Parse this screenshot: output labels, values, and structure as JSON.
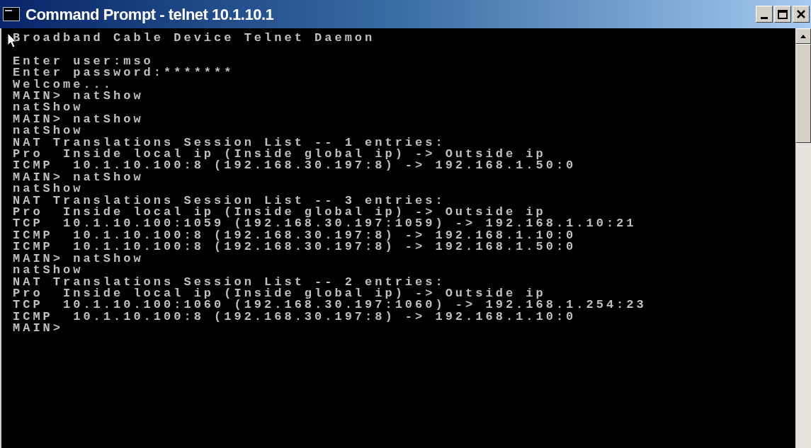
{
  "window": {
    "title": "Command Prompt - telnet 10.1.10.1"
  },
  "terminal": {
    "banner": "Broadband Cable Device Telnet Daemon",
    "lines": [
      "Enter user:mso",
      "Enter password:*******",
      "Welcome...",
      "MAIN> natShow",
      "natShow",
      "MAIN> natShow",
      "natShow",
      "NAT Translations Session List -- 1 entries:",
      "Pro  Inside local ip (Inside global ip) -> Outside ip",
      "ICMP  10.1.10.100:8 (192.168.30.197:8) -> 192.168.1.50:0",
      "MAIN> natShow",
      "natShow",
      "NAT Translations Session List -- 3 entries:",
      "Pro  Inside local ip (Inside global ip) -> Outside ip",
      "TCP  10.1.10.100:1059 (192.168.30.197:1059) -> 192.168.1.10:21",
      "ICMP  10.1.10.100:8 (192.168.30.197:8) -> 192.168.1.10:0",
      "ICMP  10.1.10.100:8 (192.168.30.197:8) -> 192.168.1.50:0",
      "MAIN> natShow",
      "natShow",
      "NAT Translations Session List -- 2 entries:",
      "Pro  Inside local ip (Inside global ip) -> Outside ip",
      "TCP  10.1.10.100:1060 (192.168.30.197:1060) -> 192.168.1.254:23",
      "ICMP  10.1.10.100:8 (192.168.30.197:8) -> 192.168.1.10:0",
      "MAIN>"
    ]
  }
}
